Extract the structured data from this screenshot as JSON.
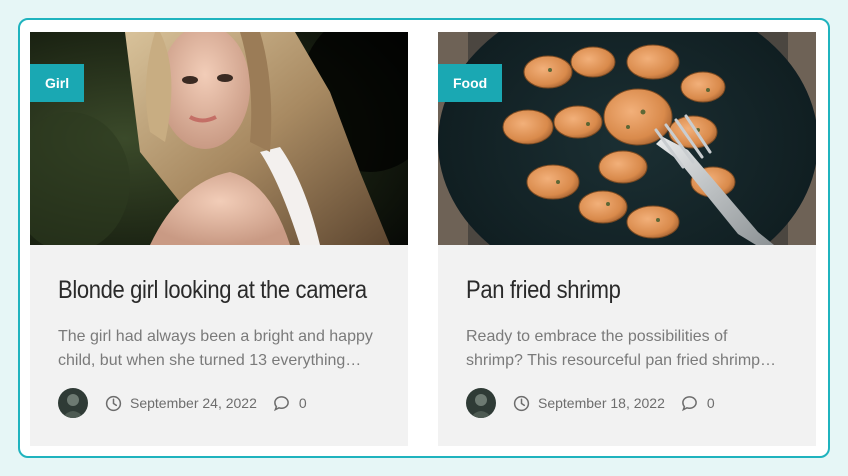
{
  "posts": [
    {
      "category": "Girl",
      "title": "Blonde girl looking at the camera",
      "excerpt_lines": [
        "The girl had always been a bright and happy",
        "child, but when she turned 13 everything…"
      ],
      "date": "September 24, 2022",
      "comments": "0"
    },
    {
      "category": "Food",
      "title": "Pan fried shrimp",
      "excerpt_lines": [
        "Ready to embrace the possibilities of",
        "shrimp? This resourceful pan fried shrimp…"
      ],
      "date": "September 18, 2022",
      "comments": "0"
    }
  ],
  "colors": {
    "accent": "#1aa8b3",
    "border": "#1fb3be",
    "card_bg": "#f2f2f2",
    "page_bg": "#e6f6f6"
  },
  "icons": [
    "clock-icon",
    "comment-icon"
  ]
}
